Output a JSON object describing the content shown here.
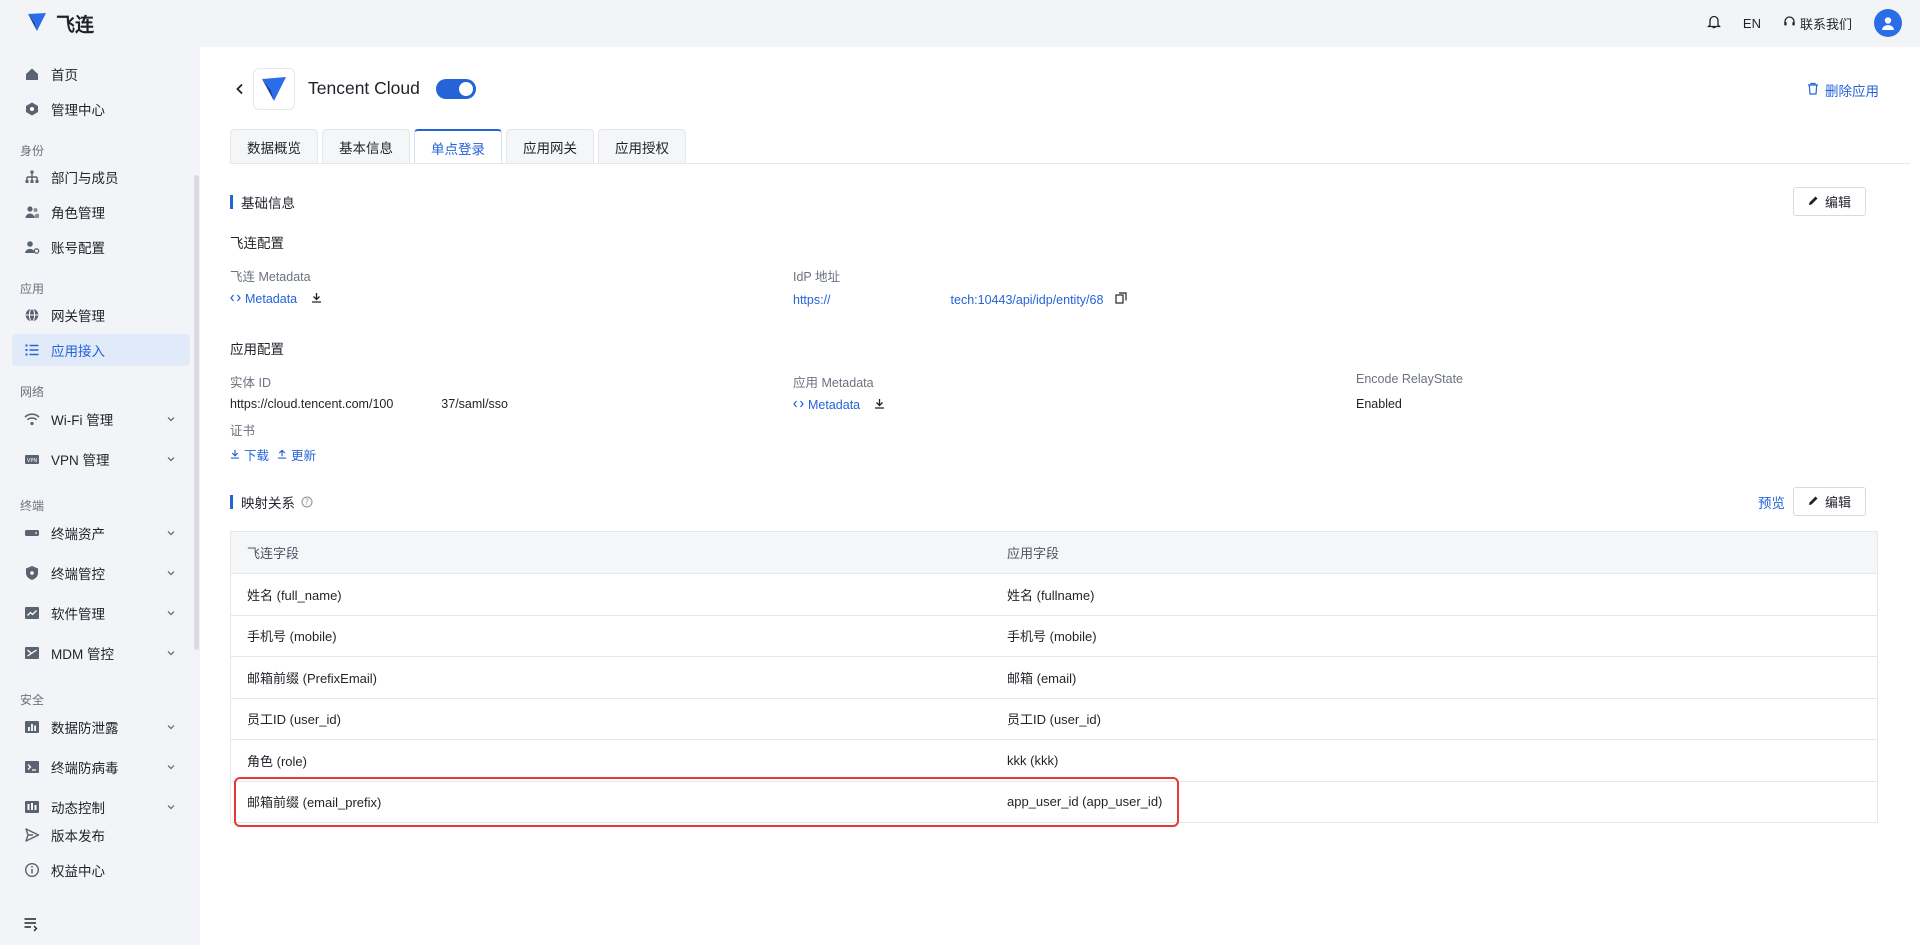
{
  "topbar": {
    "brand": "飞连",
    "lang": "EN",
    "contact": "联系我们"
  },
  "sidebar": {
    "items_top": [
      {
        "label": "首页",
        "icon": "home-icon"
      },
      {
        "label": "管理中心",
        "icon": "hub-icon"
      }
    ],
    "section_identity": "身份",
    "identity_items": [
      {
        "label": "部门与成员",
        "icon": "org-tree-icon"
      },
      {
        "label": "角色管理",
        "icon": "users-icon"
      },
      {
        "label": "账号配置",
        "icon": "user-gear-icon"
      }
    ],
    "section_app": "应用",
    "app_items": [
      {
        "label": "网关管理",
        "icon": "globe-icon"
      },
      {
        "label": "应用接入",
        "icon": "list-icon"
      }
    ],
    "section_network": "网络",
    "network_items": [
      {
        "label": "Wi-Fi 管理",
        "icon": "wifi-icon"
      },
      {
        "label": "VPN 管理",
        "icon": "vpn-icon"
      }
    ],
    "section_terminal": "终端",
    "terminal_items": [
      {
        "label": "终端资产",
        "icon": "drive-icon"
      },
      {
        "label": "终端管控",
        "icon": "shield-icon"
      },
      {
        "label": "软件管理",
        "icon": "chart-window-icon"
      },
      {
        "label": "MDM 管控",
        "icon": "mdm-icon"
      }
    ],
    "section_security": "安全",
    "security_items": [
      {
        "label": "数据防泄露",
        "icon": "bar-chart-icon"
      },
      {
        "label": "终端防病毒",
        "icon": "terminal-icon"
      },
      {
        "label": "动态控制",
        "icon": "dynamic-icon"
      },
      {
        "label": "版本发布",
        "icon": "send-icon"
      },
      {
        "label": "权益中心",
        "icon": "info-icon"
      }
    ]
  },
  "header": {
    "app_name": "Tencent Cloud",
    "enabled": true,
    "delete_label": "删除应用"
  },
  "tabs": [
    "数据概览",
    "基本信息",
    "单点登录",
    "应用网关",
    "应用授权"
  ],
  "active_tab": "单点登录",
  "basic": {
    "title": "基础信息",
    "edit_label": "编辑",
    "feilian_config": "飞连配置",
    "feilian_metadata_label": "飞连 Metadata",
    "metadata_link": "Metadata",
    "idp_label": "IdP 地址",
    "idp_prefix": "https://",
    "idp_suffix": "tech:10443/api/idp/entity/68",
    "app_config": "应用配置",
    "entity_id_label": "实体 ID",
    "entity_prefix": "https://cloud.tencent.com/100",
    "entity_suffix": "37/saml/sso",
    "app_metadata_label": "应用 Metadata",
    "encode_label": "Encode RelayState",
    "encode_value": "Enabled",
    "cert_label": "证书",
    "download_label": "下载",
    "update_label": "更新"
  },
  "mapping": {
    "title": "映射关系",
    "preview_label": "预览",
    "edit_label": "编辑",
    "columns": [
      "飞连字段",
      "应用字段"
    ],
    "rows": [
      [
        "姓名 (full_name)",
        "姓名 (fullname)"
      ],
      [
        "手机号 (mobile)",
        "手机号 (mobile)"
      ],
      [
        "邮箱前缀 (PrefixEmail)",
        "邮箱 (email)"
      ],
      [
        "员工ID (user_id)",
        "员工ID (user_id)"
      ],
      [
        "角色 (role)",
        "kkk (kkk)"
      ],
      [
        "邮箱前缀 (email_prefix)",
        "app_user_id (app_user_id)"
      ]
    ]
  },
  "colors": {
    "accent": "#2563d9",
    "highlight": "#e53935",
    "active_nav_bg": "#e1eaf9"
  }
}
